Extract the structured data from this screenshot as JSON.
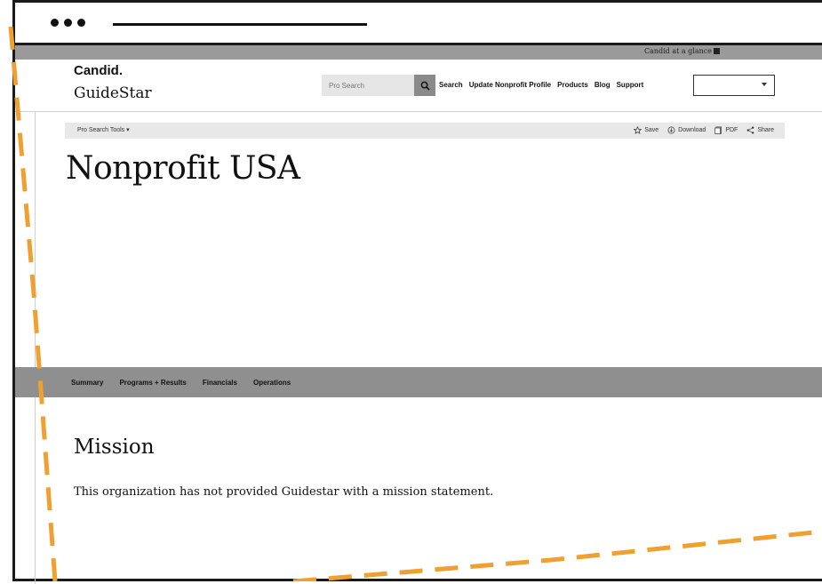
{
  "browser": {
    "window_dots": 3
  },
  "top_strip": {
    "glance_label": "Candid at a glance"
  },
  "header": {
    "brand_line1": "Candid.",
    "brand_line2": "GuideStar",
    "search_placeholder": "Pro Search",
    "search_icon": "magnifier-icon",
    "nav": [
      "Search",
      "Update Nonprofit Profile",
      "Products",
      "Blog",
      "Support"
    ],
    "language_select_value": ""
  },
  "tools": {
    "pro_search_tools_label": "Pro Search Tools",
    "actions": [
      {
        "label": "Save",
        "icon": "star-icon"
      },
      {
        "label": "Download",
        "icon": "download-icon"
      },
      {
        "label": "PDF",
        "icon": "pdf-icon"
      },
      {
        "label": "Share",
        "icon": "share-icon"
      }
    ]
  },
  "organization": {
    "name": "Nonprofit USA"
  },
  "tabs": [
    "Summary",
    "Programs + Results",
    "Financials",
    "Operations"
  ],
  "mission": {
    "heading": "Mission",
    "text": "This organization has not provided Guidestar with a mission statement."
  },
  "colors": {
    "strip_gray": "#9a9a9a",
    "tab_bar_gray": "#8f8f8f",
    "accent_dash_orange": "#f0a030"
  }
}
